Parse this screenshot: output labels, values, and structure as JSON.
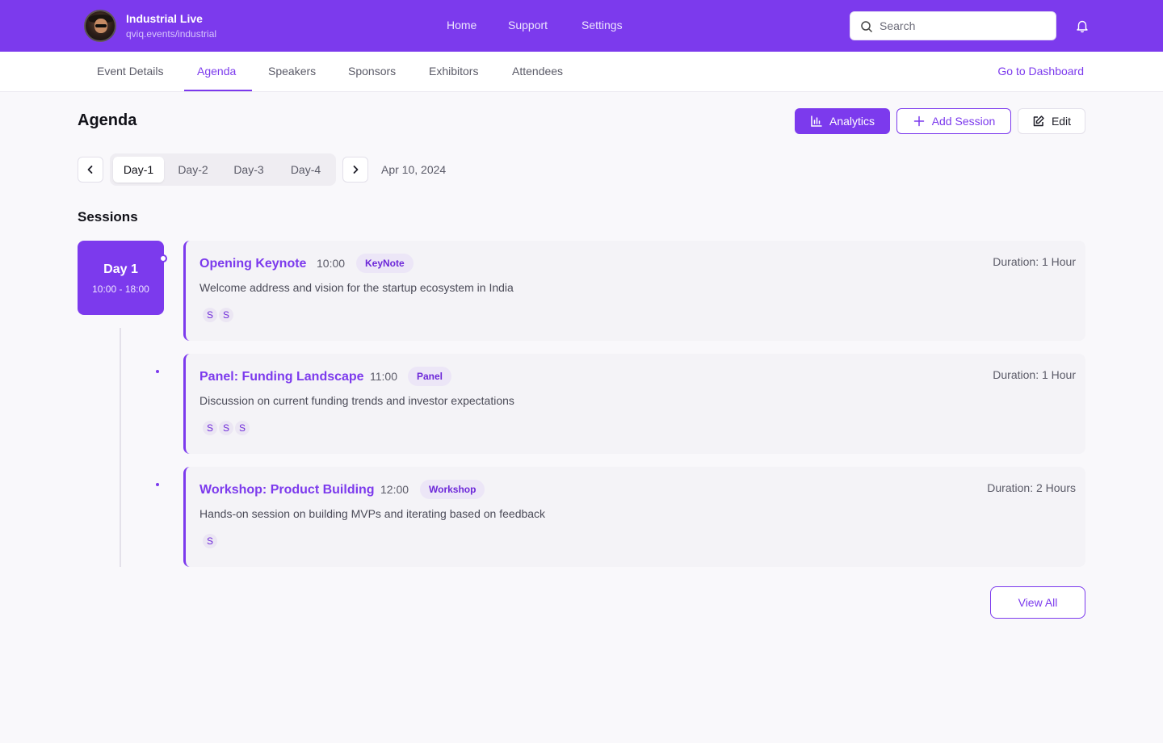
{
  "header": {
    "brand_title": "Industrial Live",
    "brand_sub": "qviq.events/industrial",
    "nav": [
      "Home",
      "Support",
      "Settings"
    ],
    "search_placeholder": "Search",
    "accent_color": "#7c3aed"
  },
  "subnav": {
    "tabs": [
      "Event Details",
      "Agenda",
      "Speakers",
      "Sponsors",
      "Exhibitors",
      "Attendees"
    ],
    "active_tab": "Agenda",
    "dashboard_link": "Go to Dashboard"
  },
  "page": {
    "title": "Agenda",
    "analytics_label": "Analytics",
    "add_session_label": "Add Session",
    "edit_label": "Edit"
  },
  "days": {
    "tabs": [
      "Day-1",
      "Day-2",
      "Day-3",
      "Day-4"
    ],
    "active": "Day-1",
    "date": "Apr 10, 2024"
  },
  "sessions": {
    "title": "Sessions",
    "day_card": {
      "day": "Day 1",
      "hours": "10:00 - 18:00"
    },
    "items": [
      {
        "title": "Opening Keynote",
        "time": "10:00",
        "tag": "KeyNote",
        "duration": "Duration: 1 Hour",
        "description": "Welcome address and vision for the startup ecosystem in India",
        "speakers": [
          "S",
          "S"
        ]
      },
      {
        "title": "Panel: Funding Landscape",
        "time": "11:00",
        "tag": "Panel",
        "duration": "Duration: 1 Hour",
        "description": "Discussion on current funding trends and investor expectations",
        "speakers": [
          "S",
          "S",
          "S"
        ]
      },
      {
        "title": "Workshop: Product Building",
        "time": "12:00",
        "tag": "Workshop",
        "duration": "Duration: 2 Hours",
        "description": "Hands-on session on building MVPs and iterating based on feedback",
        "speakers": [
          "S"
        ]
      }
    ],
    "view_all_label": "View All"
  }
}
